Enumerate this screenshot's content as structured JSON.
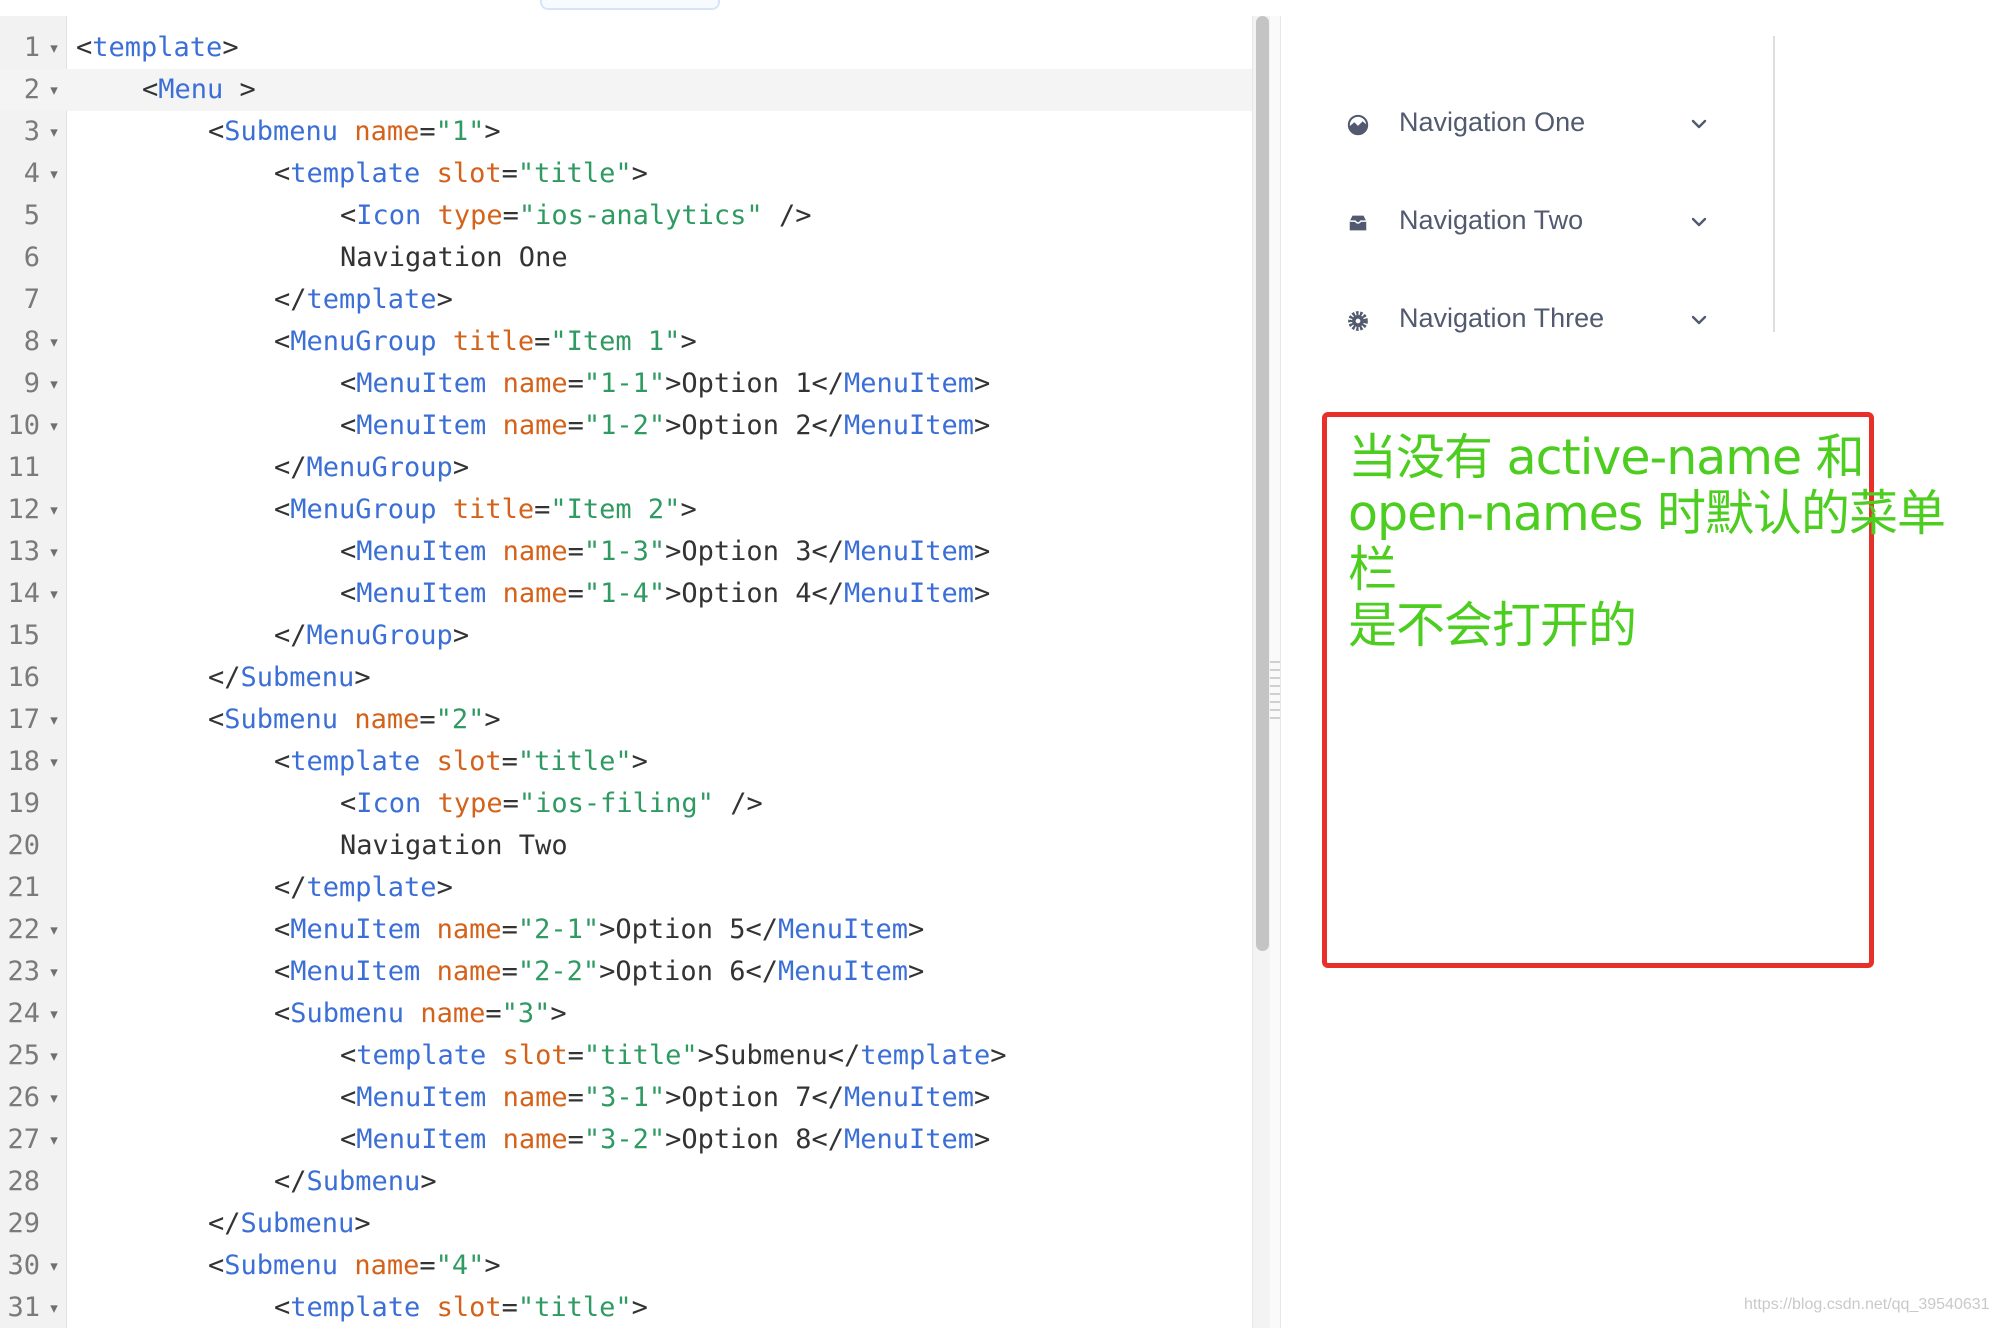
{
  "editor": {
    "lines": [
      {
        "n": "1",
        "fold": true,
        "indent": 0,
        "tokens": [
          [
            "p",
            "<"
          ],
          [
            "t",
            "template"
          ],
          [
            "p",
            ">"
          ]
        ]
      },
      {
        "n": "2",
        "fold": true,
        "indent": 1,
        "active": true,
        "tokens": [
          [
            "p",
            "<"
          ],
          [
            "t",
            "Menu"
          ],
          [
            "p",
            " >"
          ]
        ]
      },
      {
        "n": "3",
        "fold": true,
        "indent": 2,
        "tokens": [
          [
            "p",
            "<"
          ],
          [
            "t",
            "Submenu"
          ],
          [
            "p",
            " "
          ],
          [
            "a",
            "name"
          ],
          [
            "p",
            "="
          ],
          [
            "s",
            "\"1\""
          ],
          [
            "p",
            ">"
          ]
        ]
      },
      {
        "n": "4",
        "fold": true,
        "indent": 3,
        "tokens": [
          [
            "p",
            "<"
          ],
          [
            "t",
            "template"
          ],
          [
            "p",
            " "
          ],
          [
            "a",
            "slot"
          ],
          [
            "p",
            "="
          ],
          [
            "s",
            "\"title\""
          ],
          [
            "p",
            ">"
          ]
        ]
      },
      {
        "n": "5",
        "fold": false,
        "indent": 4,
        "tokens": [
          [
            "p",
            "<"
          ],
          [
            "t",
            "Icon"
          ],
          [
            "p",
            " "
          ],
          [
            "a",
            "type"
          ],
          [
            "p",
            "="
          ],
          [
            "s",
            "\"ios-analytics\""
          ],
          [
            "p",
            " />"
          ]
        ]
      },
      {
        "n": "6",
        "fold": false,
        "indent": 4,
        "tokens": [
          [
            "p",
            "Navigation One"
          ]
        ]
      },
      {
        "n": "7",
        "fold": false,
        "indent": 3,
        "tokens": [
          [
            "p",
            "</"
          ],
          [
            "t",
            "template"
          ],
          [
            "p",
            ">"
          ]
        ]
      },
      {
        "n": "8",
        "fold": true,
        "indent": 3,
        "tokens": [
          [
            "p",
            "<"
          ],
          [
            "t",
            "MenuGroup"
          ],
          [
            "p",
            " "
          ],
          [
            "a",
            "title"
          ],
          [
            "p",
            "="
          ],
          [
            "s",
            "\"Item 1\""
          ],
          [
            "p",
            ">"
          ]
        ]
      },
      {
        "n": "9",
        "fold": true,
        "indent": 4,
        "tokens": [
          [
            "p",
            "<"
          ],
          [
            "t",
            "MenuItem"
          ],
          [
            "p",
            " "
          ],
          [
            "a",
            "name"
          ],
          [
            "p",
            "="
          ],
          [
            "s",
            "\"1-1\""
          ],
          [
            "p",
            ">Option 1</"
          ],
          [
            "t",
            "MenuItem"
          ],
          [
            "p",
            ">"
          ]
        ]
      },
      {
        "n": "10",
        "fold": true,
        "indent": 4,
        "tokens": [
          [
            "p",
            "<"
          ],
          [
            "t",
            "MenuItem"
          ],
          [
            "p",
            " "
          ],
          [
            "a",
            "name"
          ],
          [
            "p",
            "="
          ],
          [
            "s",
            "\"1-2\""
          ],
          [
            "p",
            ">Option 2</"
          ],
          [
            "t",
            "MenuItem"
          ],
          [
            "p",
            ">"
          ]
        ]
      },
      {
        "n": "11",
        "fold": false,
        "indent": 3,
        "tokens": [
          [
            "p",
            "</"
          ],
          [
            "t",
            "MenuGroup"
          ],
          [
            "p",
            ">"
          ]
        ]
      },
      {
        "n": "12",
        "fold": true,
        "indent": 3,
        "tokens": [
          [
            "p",
            "<"
          ],
          [
            "t",
            "MenuGroup"
          ],
          [
            "p",
            " "
          ],
          [
            "a",
            "title"
          ],
          [
            "p",
            "="
          ],
          [
            "s",
            "\"Item 2\""
          ],
          [
            "p",
            ">"
          ]
        ]
      },
      {
        "n": "13",
        "fold": true,
        "indent": 4,
        "tokens": [
          [
            "p",
            "<"
          ],
          [
            "t",
            "MenuItem"
          ],
          [
            "p",
            " "
          ],
          [
            "a",
            "name"
          ],
          [
            "p",
            "="
          ],
          [
            "s",
            "\"1-3\""
          ],
          [
            "p",
            ">Option 3</"
          ],
          [
            "t",
            "MenuItem"
          ],
          [
            "p",
            ">"
          ]
        ]
      },
      {
        "n": "14",
        "fold": true,
        "indent": 4,
        "tokens": [
          [
            "p",
            "<"
          ],
          [
            "t",
            "MenuItem"
          ],
          [
            "p",
            " "
          ],
          [
            "a",
            "name"
          ],
          [
            "p",
            "="
          ],
          [
            "s",
            "\"1-4\""
          ],
          [
            "p",
            ">Option 4</"
          ],
          [
            "t",
            "MenuItem"
          ],
          [
            "p",
            ">"
          ]
        ]
      },
      {
        "n": "15",
        "fold": false,
        "indent": 3,
        "tokens": [
          [
            "p",
            "</"
          ],
          [
            "t",
            "MenuGroup"
          ],
          [
            "p",
            ">"
          ]
        ]
      },
      {
        "n": "16",
        "fold": false,
        "indent": 2,
        "tokens": [
          [
            "p",
            "</"
          ],
          [
            "t",
            "Submenu"
          ],
          [
            "p",
            ">"
          ]
        ]
      },
      {
        "n": "17",
        "fold": true,
        "indent": 2,
        "tokens": [
          [
            "p",
            "<"
          ],
          [
            "t",
            "Submenu"
          ],
          [
            "p",
            " "
          ],
          [
            "a",
            "name"
          ],
          [
            "p",
            "="
          ],
          [
            "s",
            "\"2\""
          ],
          [
            "p",
            ">"
          ]
        ]
      },
      {
        "n": "18",
        "fold": true,
        "indent": 3,
        "tokens": [
          [
            "p",
            "<"
          ],
          [
            "t",
            "template"
          ],
          [
            "p",
            " "
          ],
          [
            "a",
            "slot"
          ],
          [
            "p",
            "="
          ],
          [
            "s",
            "\"title\""
          ],
          [
            "p",
            ">"
          ]
        ]
      },
      {
        "n": "19",
        "fold": false,
        "indent": 4,
        "tokens": [
          [
            "p",
            "<"
          ],
          [
            "t",
            "Icon"
          ],
          [
            "p",
            " "
          ],
          [
            "a",
            "type"
          ],
          [
            "p",
            "="
          ],
          [
            "s",
            "\"ios-filing\""
          ],
          [
            "p",
            " />"
          ]
        ]
      },
      {
        "n": "20",
        "fold": false,
        "indent": 4,
        "tokens": [
          [
            "p",
            "Navigation Two"
          ]
        ]
      },
      {
        "n": "21",
        "fold": false,
        "indent": 3,
        "tokens": [
          [
            "p",
            "</"
          ],
          [
            "t",
            "template"
          ],
          [
            "p",
            ">"
          ]
        ]
      },
      {
        "n": "22",
        "fold": true,
        "indent": 3,
        "tokens": [
          [
            "p",
            "<"
          ],
          [
            "t",
            "MenuItem"
          ],
          [
            "p",
            " "
          ],
          [
            "a",
            "name"
          ],
          [
            "p",
            "="
          ],
          [
            "s",
            "\"2-1\""
          ],
          [
            "p",
            ">Option 5</"
          ],
          [
            "t",
            "MenuItem"
          ],
          [
            "p",
            ">"
          ]
        ]
      },
      {
        "n": "23",
        "fold": true,
        "indent": 3,
        "tokens": [
          [
            "p",
            "<"
          ],
          [
            "t",
            "MenuItem"
          ],
          [
            "p",
            " "
          ],
          [
            "a",
            "name"
          ],
          [
            "p",
            "="
          ],
          [
            "s",
            "\"2-2\""
          ],
          [
            "p",
            ">Option 6</"
          ],
          [
            "t",
            "MenuItem"
          ],
          [
            "p",
            ">"
          ]
        ]
      },
      {
        "n": "24",
        "fold": true,
        "indent": 3,
        "tokens": [
          [
            "p",
            "<"
          ],
          [
            "t",
            "Submenu"
          ],
          [
            "p",
            " "
          ],
          [
            "a",
            "name"
          ],
          [
            "p",
            "="
          ],
          [
            "s",
            "\"3\""
          ],
          [
            "p",
            ">"
          ]
        ]
      },
      {
        "n": "25",
        "fold": true,
        "indent": 4,
        "tokens": [
          [
            "p",
            "<"
          ],
          [
            "t",
            "template"
          ],
          [
            "p",
            " "
          ],
          [
            "a",
            "slot"
          ],
          [
            "p",
            "="
          ],
          [
            "s",
            "\"title\""
          ],
          [
            "p",
            ">Submenu</"
          ],
          [
            "t",
            "template"
          ],
          [
            "p",
            ">"
          ]
        ]
      },
      {
        "n": "26",
        "fold": true,
        "indent": 4,
        "tokens": [
          [
            "p",
            "<"
          ],
          [
            "t",
            "MenuItem"
          ],
          [
            "p",
            " "
          ],
          [
            "a",
            "name"
          ],
          [
            "p",
            "="
          ],
          [
            "s",
            "\"3-1\""
          ],
          [
            "p",
            ">Option 7</"
          ],
          [
            "t",
            "MenuItem"
          ],
          [
            "p",
            ">"
          ]
        ]
      },
      {
        "n": "27",
        "fold": true,
        "indent": 4,
        "tokens": [
          [
            "p",
            "<"
          ],
          [
            "t",
            "MenuItem"
          ],
          [
            "p",
            " "
          ],
          [
            "a",
            "name"
          ],
          [
            "p",
            "="
          ],
          [
            "s",
            "\"3-2\""
          ],
          [
            "p",
            ">Option 8</"
          ],
          [
            "t",
            "MenuItem"
          ],
          [
            "p",
            ">"
          ]
        ]
      },
      {
        "n": "28",
        "fold": false,
        "indent": 3,
        "tokens": [
          [
            "p",
            "</"
          ],
          [
            "t",
            "Submenu"
          ],
          [
            "p",
            ">"
          ]
        ]
      },
      {
        "n": "29",
        "fold": false,
        "indent": 2,
        "tokens": [
          [
            "p",
            "</"
          ],
          [
            "t",
            "Submenu"
          ],
          [
            "p",
            ">"
          ]
        ]
      },
      {
        "n": "30",
        "fold": true,
        "indent": 2,
        "tokens": [
          [
            "p",
            "<"
          ],
          [
            "t",
            "Submenu"
          ],
          [
            "p",
            " "
          ],
          [
            "a",
            "name"
          ],
          [
            "p",
            "="
          ],
          [
            "s",
            "\"4\""
          ],
          [
            "p",
            ">"
          ]
        ]
      },
      {
        "n": "31",
        "fold": true,
        "indent": 3,
        "tokens": [
          [
            "p",
            "<"
          ],
          [
            "t",
            "template"
          ],
          [
            "p",
            " "
          ],
          [
            "a",
            "slot"
          ],
          [
            "p",
            "="
          ],
          [
            "s",
            "\"title\""
          ],
          [
            "p",
            ">"
          ]
        ]
      }
    ]
  },
  "preview": {
    "menu": [
      {
        "label": "Navigation One",
        "icon": "ios-analytics-icon"
      },
      {
        "label": "Navigation Two",
        "icon": "ios-filing-icon"
      },
      {
        "label": "Navigation Three",
        "icon": "gear-icon"
      }
    ],
    "annotation": {
      "lines": [
        "当没有 active-name 和",
        "open-names 时默认的菜单栏",
        "是不会打开的"
      ],
      "color": "#4ccd20",
      "border_color": "#e8302a"
    },
    "watermark": "https://blog.csdn.net/qq_39540631"
  },
  "colors": {
    "tag": "#3b6fd6",
    "attribute": "#d4621a",
    "string": "#2f9a62",
    "text": "#333333",
    "menu_text": "#515a6e"
  }
}
